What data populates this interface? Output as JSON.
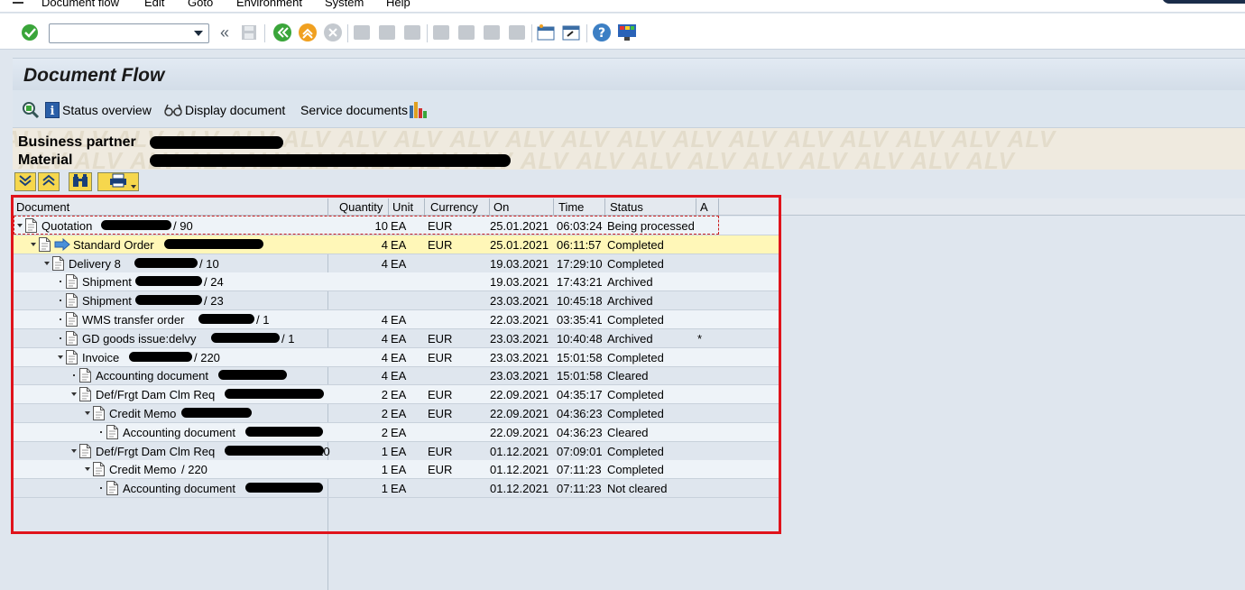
{
  "menu": [
    "Document flow",
    "Edit",
    "Goto",
    "Environment",
    "System",
    "Help"
  ],
  "command_field": {
    "value": ""
  },
  "title": "Document Flow",
  "app_toolbar": {
    "status_overview": "Status overview",
    "display_document": "Display document",
    "service_documents": "Service documents"
  },
  "header": {
    "watermark": "ALV",
    "business_partner_label": "Business partner",
    "material_label": "Material"
  },
  "columns": [
    "Document",
    "Quantity",
    "Unit",
    "Currency",
    "On",
    "Time",
    "Status",
    "A"
  ],
  "rows": [
    {
      "level": 0,
      "expand": "open",
      "icon": "document",
      "doc": "Quotation",
      "suffix": "/ 90",
      "qty": "10",
      "unit": "EA",
      "cur": "EUR",
      "on": "25.01.2021",
      "time": "06:03:24",
      "status": "Being processed",
      "a": "",
      "state": "selected"
    },
    {
      "level": 1,
      "expand": "open",
      "icon": "document-current",
      "doc": "Standard Order",
      "suffix": "",
      "qty": "4",
      "unit": "EA",
      "cur": "EUR",
      "on": "25.01.2021",
      "time": "06:11:57",
      "status": "Completed",
      "a": "",
      "state": "current"
    },
    {
      "level": 2,
      "expand": "open",
      "icon": "document",
      "doc": "Delivery 8",
      "suffix": "/ 10",
      "qty": "4",
      "unit": "EA",
      "cur": "",
      "on": "19.03.2021",
      "time": "17:29:10",
      "status": "Completed",
      "a": ""
    },
    {
      "level": 3,
      "expand": "leaf",
      "icon": "document",
      "doc": "Shipment",
      "suffix": "/ 24",
      "qty": "",
      "unit": "",
      "cur": "",
      "on": "19.03.2021",
      "time": "17:43:21",
      "status": "Archived",
      "a": ""
    },
    {
      "level": 3,
      "expand": "leaf",
      "icon": "document",
      "doc": "Shipment",
      "suffix": "/ 23",
      "qty": "",
      "unit": "",
      "cur": "",
      "on": "23.03.2021",
      "time": "10:45:18",
      "status": "Archived",
      "a": ""
    },
    {
      "level": 3,
      "expand": "leaf",
      "icon": "document",
      "doc": "WMS transfer order",
      "suffix": "/ 1",
      "qty": "4",
      "unit": "EA",
      "cur": "",
      "on": "22.03.2021",
      "time": "03:35:41",
      "status": "Completed",
      "a": ""
    },
    {
      "level": 3,
      "expand": "leaf",
      "icon": "document",
      "doc": "GD goods issue:delvy",
      "suffix": "/ 1",
      "qty": "4",
      "unit": "EA",
      "cur": "EUR",
      "on": "23.03.2021",
      "time": "10:40:48",
      "status": "Archived",
      "a": "*"
    },
    {
      "level": 3,
      "expand": "open",
      "icon": "document",
      "doc": "Invoice",
      "suffix": "/ 220",
      "qty": "4",
      "unit": "EA",
      "cur": "EUR",
      "on": "23.03.2021",
      "time": "15:01:58",
      "status": "Completed",
      "a": ""
    },
    {
      "level": 4,
      "expand": "leaf",
      "icon": "document",
      "doc": "Accounting document",
      "suffix": "",
      "qty": "4",
      "unit": "EA",
      "cur": "",
      "on": "23.03.2021",
      "time": "15:01:58",
      "status": "Cleared",
      "a": ""
    },
    {
      "level": 4,
      "expand": "open",
      "icon": "document",
      "doc": "Def/Frgt Dam Clm Req",
      "suffix": "",
      "qty": "2",
      "unit": "EA",
      "cur": "EUR",
      "on": "22.09.2021",
      "time": "04:35:17",
      "status": "Completed",
      "a": ""
    },
    {
      "level": 5,
      "expand": "open",
      "icon": "document",
      "doc": "Credit Memo",
      "suffix": "",
      "qty": "2",
      "unit": "EA",
      "cur": "EUR",
      "on": "22.09.2021",
      "time": "04:36:23",
      "status": "Completed",
      "a": ""
    },
    {
      "level": 6,
      "expand": "leaf",
      "icon": "document",
      "doc": "Accounting document",
      "suffix": "",
      "qty": "2",
      "unit": "EA",
      "cur": "",
      "on": "22.09.2021",
      "time": "04:36:23",
      "status": "Cleared",
      "a": ""
    },
    {
      "level": 4,
      "expand": "open",
      "icon": "document",
      "doc": "Def/Frgt Dam Clm Req",
      "suffix": "220",
      "qty": "1",
      "unit": "EA",
      "cur": "EUR",
      "on": "01.12.2021",
      "time": "07:09:01",
      "status": "Completed",
      "a": ""
    },
    {
      "level": 5,
      "expand": "open",
      "icon": "document",
      "doc": "Credit Memo",
      "suffix": "/ 220",
      "qty": "1",
      "unit": "EA",
      "cur": "EUR",
      "on": "01.12.2021",
      "time": "07:11:23",
      "status": "Completed",
      "a": ""
    },
    {
      "level": 6,
      "expand": "leaf",
      "icon": "document",
      "doc": "Accounting document",
      "suffix": "",
      "qty": "1",
      "unit": "EA",
      "cur": "",
      "on": "01.12.2021",
      "time": "07:11:23",
      "status": "Not cleared",
      "a": ""
    }
  ],
  "colors": {
    "selected_row": "#fff7b8",
    "annotation_border": "#e0131b",
    "confirm_green": "#3aa53a",
    "button_yellow": "#f6d74d"
  }
}
